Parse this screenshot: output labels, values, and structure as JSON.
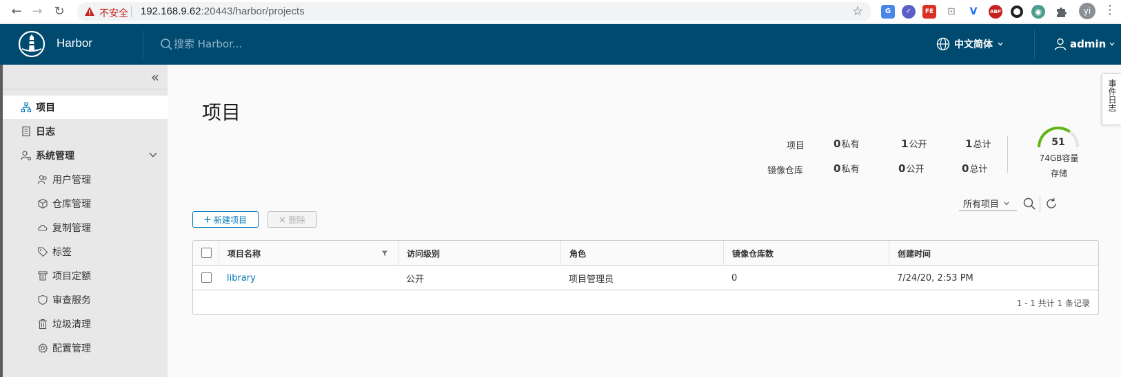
{
  "browser": {
    "insecure_label": "不安全",
    "url_host": "192.168.9.62",
    "url_rest": ":20443/harbor/projects",
    "profile_initials": "yi",
    "extensions": [
      {
        "name": "translate-ext-icon",
        "label": "G",
        "color": "#4a86e8"
      },
      {
        "name": "check-ext-icon",
        "label": "✓",
        "color": "#5b5fc7"
      },
      {
        "name": "fe-ext-icon",
        "label": "FE",
        "color": "#d93025"
      },
      {
        "name": "screenshot-ext-icon",
        "label": "⊡",
        "color": "#9aa0a6"
      },
      {
        "name": "vue-ext-icon",
        "label": "V",
        "color": "#1a73e8"
      },
      {
        "name": "abp-ext-icon",
        "label": "ABP",
        "color": "#c5221f"
      },
      {
        "name": "circle-ext-icon",
        "label": "",
        "color": "#202124"
      },
      {
        "name": "shield-ext-icon",
        "label": "◉",
        "color": "#4a9d8f"
      },
      {
        "name": "puzzle-ext-icon",
        "label": "",
        "color": "#5f6368"
      }
    ]
  },
  "header": {
    "app_title": "Harbor",
    "search_placeholder": "搜索 Harbor...",
    "language": "中文简体",
    "user": "admin"
  },
  "sidebar": {
    "items": [
      {
        "label": "项目"
      },
      {
        "label": "日志"
      },
      {
        "label": "系统管理"
      },
      {
        "label": "用户管理"
      },
      {
        "label": "仓库管理"
      },
      {
        "label": "复制管理"
      },
      {
        "label": "标签"
      },
      {
        "label": "项目定额"
      },
      {
        "label": "审查服务"
      },
      {
        "label": "垃圾清理"
      },
      {
        "label": "配置管理"
      }
    ]
  },
  "main": {
    "title": "项目",
    "stats": {
      "row_projects_label": "项目",
      "row_repos_label": "镜像仓库",
      "private_label": "私有",
      "public_label": "公开",
      "total_label": "总计",
      "projects": {
        "private": "0",
        "public": "1",
        "total": "1"
      },
      "repos": {
        "private": "0",
        "public": "0",
        "total": "0"
      }
    },
    "storage": {
      "value": "51",
      "capacity": "74GB容量",
      "label": "存储",
      "used_fraction": 0.7
    },
    "buttons": {
      "new_project": "新建项目",
      "delete": "删除"
    },
    "filter": {
      "selected": "所有项目"
    },
    "table": {
      "columns": [
        "项目名称",
        "访问级别",
        "角色",
        "镜像仓库数",
        "创建时间"
      ],
      "rows": [
        {
          "name": "library",
          "access": "公开",
          "role": "项目管理员",
          "repo_count": "0",
          "created": "7/24/20, 2:53 PM"
        }
      ],
      "footer": "1 - 1 共计 1 条记录"
    }
  },
  "event_log_tab": "事件日志",
  "colors": {
    "header_bg": "#004a70",
    "accent": "#0079b8",
    "gauge": "#60b515"
  }
}
